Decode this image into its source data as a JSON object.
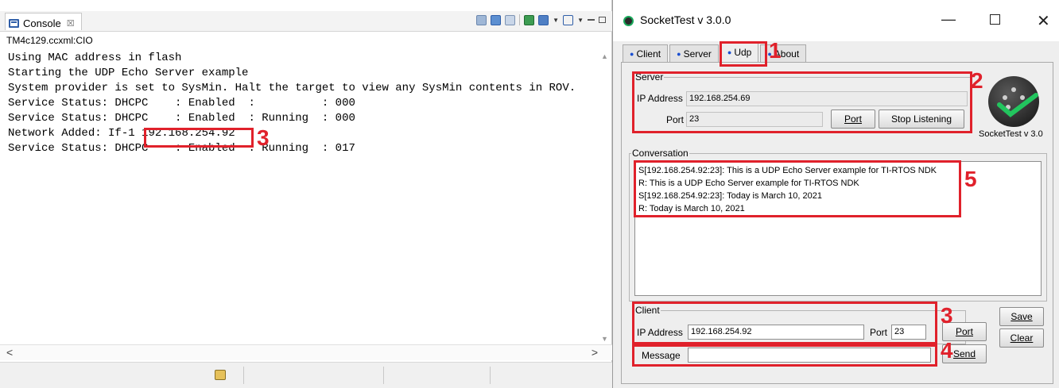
{
  "console": {
    "tab_label": "Console",
    "tab_close": "☒",
    "target": "TM4c129.ccxml:CIO",
    "lines": [
      "Using MAC address in flash",
      "Starting the UDP Echo Server example",
      "System provider is set to SysMin. Halt the target to view any SysMin contents in ROV.",
      "Service Status: DHCPC    : Enabled  :          : 000",
      "Service Status: DHCPC    : Enabled  : Running  : 000",
      "Network Added: If-1",
      "Service Status: DHCPC    : Enabled  : Running  : 017"
    ],
    "network_ip": "192.168.254.92",
    "scroll_left": "<",
    "scroll_right": ">"
  },
  "socket_test": {
    "title": "SocketTest v 3.0.0",
    "tabs": [
      "Client",
      "Server",
      "Udp",
      "About"
    ],
    "active_tab": "Udp",
    "server": {
      "legend": "Server",
      "ip_label": "IP Address",
      "ip_value": "192.168.254.69",
      "port_label": "Port",
      "port_value": "23",
      "port_button": "Port",
      "stop_button": "Stop Listening"
    },
    "logo_text": "SocketTest v 3.0",
    "conversation": {
      "legend": "Conversation",
      "lines": [
        "S[192.168.254.92:23]: This is a UDP Echo Server example for TI-RTOS NDK",
        "R: This is a UDP Echo Server example for TI-RTOS NDK",
        "S[192.168.254.92:23]: Today is March 10, 2021",
        "R: Today is March 10, 2021"
      ]
    },
    "client": {
      "legend": "Client",
      "ip_label": "IP Address",
      "ip_value": "192.168.254.92",
      "port_label": "Port",
      "port_value": "23",
      "port_button": "Port"
    },
    "message": {
      "label": "Message",
      "value": "",
      "send_button": "Send"
    },
    "save_button": "Save",
    "clear_button": "Clear"
  },
  "annotations": [
    "1",
    "2",
    "3",
    "3",
    "4",
    "5"
  ],
  "colors": {
    "annotation_red": "#e0212b",
    "tab_bullet": "#1a4fd1",
    "logo_check": "#22c55e"
  }
}
